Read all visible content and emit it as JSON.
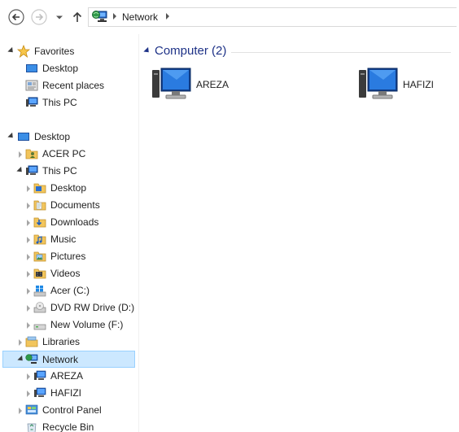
{
  "address_bar": {
    "breadcrumb": "Network"
  },
  "nav_pane": {
    "favorites": {
      "label": "Favorites",
      "items": [
        {
          "label": "Desktop",
          "icon": "desktop-icon"
        },
        {
          "label": "Recent places",
          "icon": "recent-places-icon"
        },
        {
          "label": "This PC",
          "icon": "this-pc-icon"
        }
      ]
    },
    "desktop": {
      "label": "Desktop",
      "items": [
        {
          "label": "ACER PC",
          "icon": "user-folder-icon"
        },
        {
          "label": "This PC",
          "icon": "this-pc-icon"
        }
      ]
    },
    "this_pc_children": [
      {
        "label": "Desktop",
        "icon": "desktop-folder-icon"
      },
      {
        "label": "Documents",
        "icon": "documents-folder-icon"
      },
      {
        "label": "Downloads",
        "icon": "downloads-folder-icon"
      },
      {
        "label": "Music",
        "icon": "music-folder-icon"
      },
      {
        "label": "Pictures",
        "icon": "pictures-folder-icon"
      },
      {
        "label": "Videos",
        "icon": "videos-folder-icon"
      },
      {
        "label": "Acer (C:)",
        "icon": "windows-drive-icon"
      },
      {
        "label": "DVD RW Drive (D:)",
        "icon": "dvd-drive-icon"
      },
      {
        "label": "New Volume (F:)",
        "icon": "drive-icon"
      }
    ],
    "libraries": {
      "label": "Libraries",
      "icon": "libraries-icon"
    },
    "network": {
      "label": "Network",
      "icon": "network-icon",
      "children": [
        {
          "label": "AREZA",
          "icon": "computer-icon"
        },
        {
          "label": "HAFIZI",
          "icon": "computer-icon"
        }
      ]
    },
    "control_panel": {
      "label": "Control Panel",
      "icon": "control-panel-icon"
    },
    "recycle_bin": {
      "label": "Recycle Bin",
      "icon": "recycle-bin-icon"
    }
  },
  "content": {
    "group_title": "Computer (2)",
    "items": [
      {
        "label": "AREZA",
        "icon": "computer-icon"
      },
      {
        "label": "HAFIZI",
        "icon": "computer-icon"
      }
    ]
  },
  "colors": {
    "selection_bg": "#cce8ff",
    "selection_border": "#99d1ff",
    "group_title": "#1e3287"
  }
}
